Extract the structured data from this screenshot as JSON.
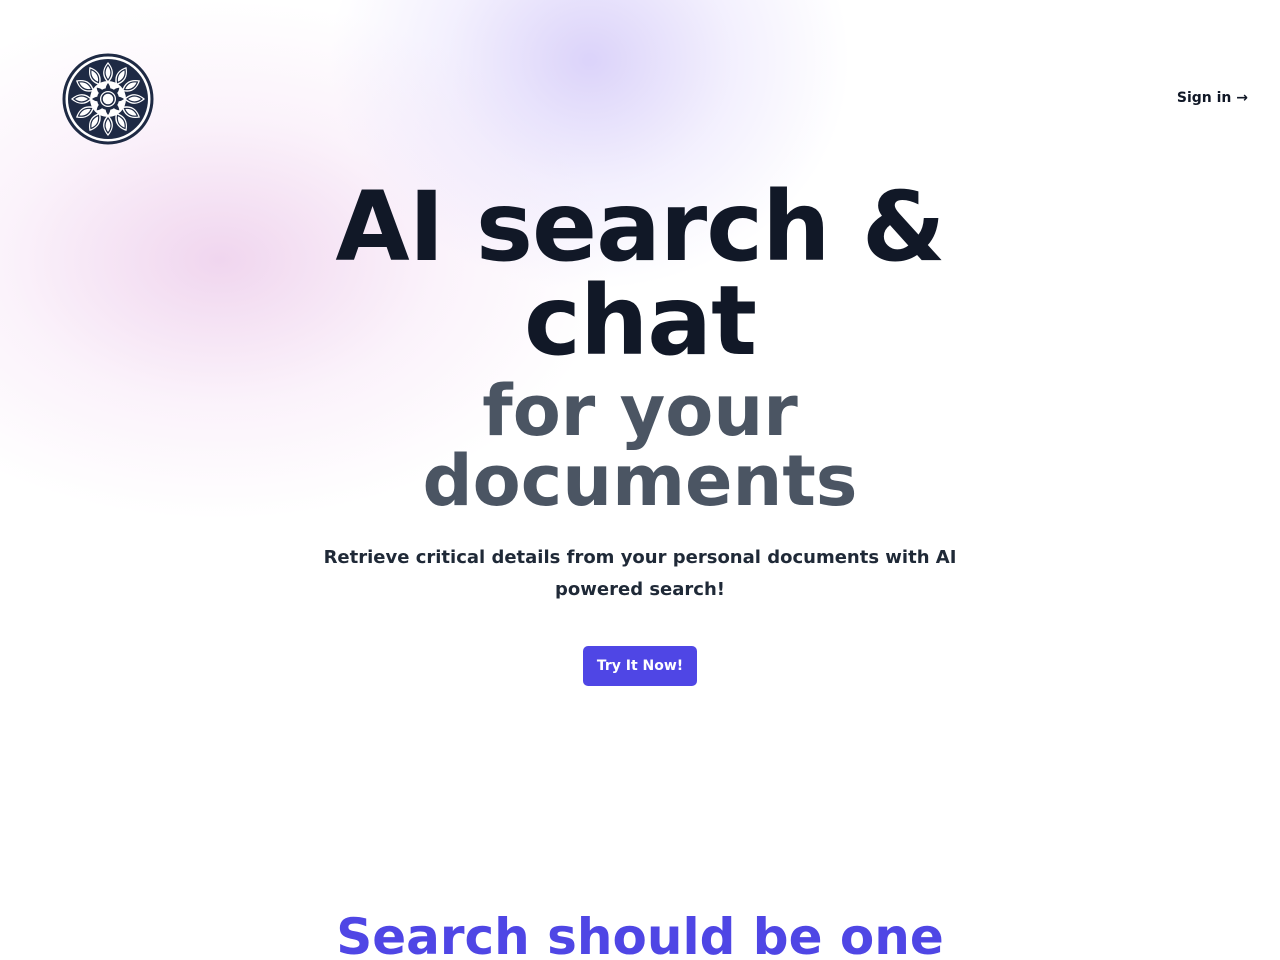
{
  "header": {
    "logo_icon": "mandala-icon",
    "signin_label": "Sign in →"
  },
  "hero": {
    "headline": "AI search & chat",
    "subheadline": "for your documents",
    "tagline": "Retrieve critical details from your personal documents with AI powered search!",
    "cta_label": "Try It Now!"
  },
  "features": {
    "heading": "Search should be one"
  },
  "colors": {
    "accent": "#4f46e5",
    "headline": "#111827",
    "subheadline": "#4b5563",
    "logo": "#1e2a44"
  }
}
